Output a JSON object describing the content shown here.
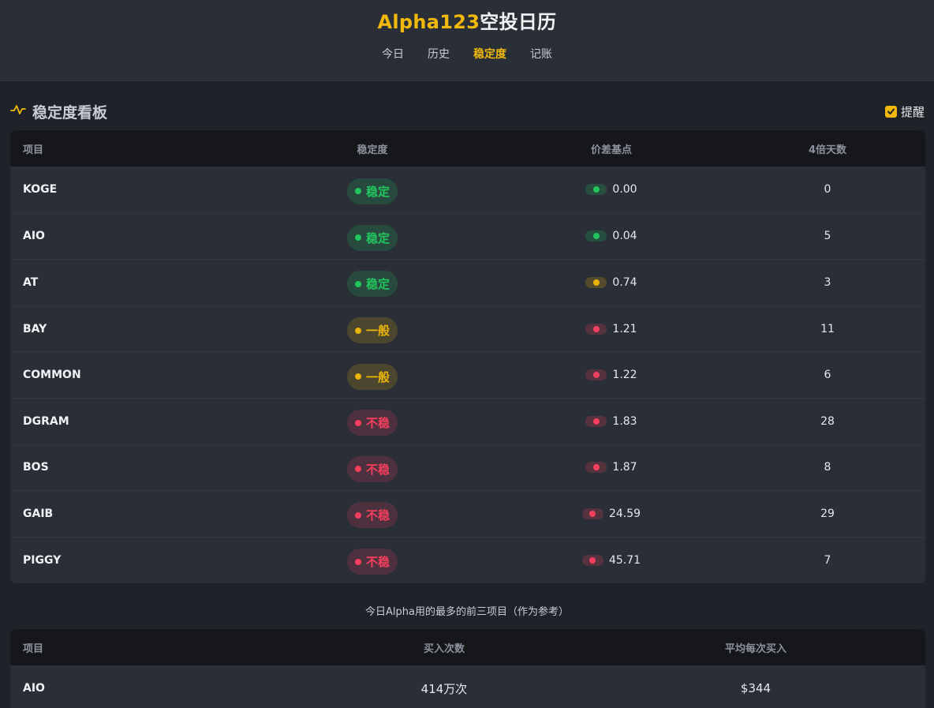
{
  "app": {
    "title_accent": "Alpha123",
    "title_rest": "空投日历"
  },
  "nav": [
    {
      "label": "今日",
      "active": false
    },
    {
      "label": "历史",
      "active": false
    },
    {
      "label": "稳定度",
      "active": true
    },
    {
      "label": "记账",
      "active": false
    }
  ],
  "dashboard": {
    "icon": "pulse-icon",
    "title": "稳定度看板",
    "remind_label": "提醒",
    "remind_checked": true
  },
  "stability_table": {
    "headers": [
      "项目",
      "稳定度",
      "价差基点",
      "4倍天数"
    ],
    "rows": [
      {
        "name": "KOGE",
        "status": "稳定",
        "level": "stable",
        "spread": "0.00",
        "spread_level": "stable",
        "days": "0"
      },
      {
        "name": "AIO",
        "status": "稳定",
        "level": "stable",
        "spread": "0.04",
        "spread_level": "stable",
        "days": "5"
      },
      {
        "name": "AT",
        "status": "稳定",
        "level": "stable",
        "spread": "0.74",
        "spread_level": "normal",
        "days": "3"
      },
      {
        "name": "BAY",
        "status": "一般",
        "level": "normal",
        "spread": "1.21",
        "spread_level": "unstable",
        "days": "11"
      },
      {
        "name": "COMMON",
        "status": "一般",
        "level": "normal",
        "spread": "1.22",
        "spread_level": "unstable",
        "days": "6"
      },
      {
        "name": "DGRAM",
        "status": "不稳",
        "level": "unstable",
        "spread": "1.83",
        "spread_level": "unstable",
        "days": "28"
      },
      {
        "name": "BOS",
        "status": "不稳",
        "level": "unstable",
        "spread": "1.87",
        "spread_level": "unstable",
        "days": "8"
      },
      {
        "name": "GAIB",
        "status": "不稳",
        "level": "unstable",
        "spread": "24.59",
        "spread_level": "unstable",
        "days": "29"
      },
      {
        "name": "PIGGY",
        "status": "不稳",
        "level": "unstable",
        "spread": "45.71",
        "spread_level": "unstable",
        "days": "7"
      }
    ]
  },
  "reference": {
    "caption": "今日Alpha用的最多的前三项目（作为参考）",
    "headers": [
      "项目",
      "买入次数",
      "平均每次买入"
    ],
    "rows": [
      {
        "name": "AIO",
        "buys": "414万次",
        "avg": "$344"
      }
    ]
  },
  "colors": {
    "accent": "#f0b90b",
    "stable": "#22c55e",
    "normal": "#eab308",
    "unstable": "#f43f5e"
  }
}
